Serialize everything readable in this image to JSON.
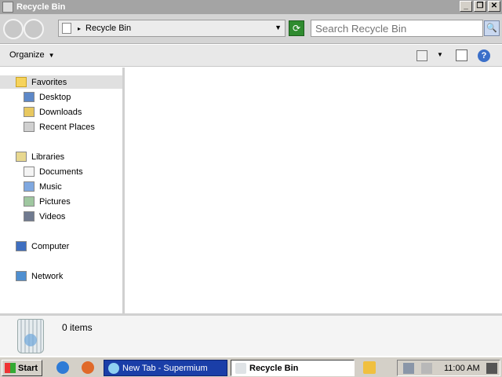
{
  "window": {
    "title": "Recycle Bin",
    "controls": {
      "minimize": "_",
      "maximize": "❐",
      "close": "✕"
    }
  },
  "address": {
    "arrow": "▸",
    "location": "Recycle Bin",
    "dropdown": "▼",
    "refresh_glyph": "⟳"
  },
  "search": {
    "placeholder": "Search Recycle Bin",
    "button_glyph": "🔍"
  },
  "toolbar": {
    "organize": "Organize",
    "caret": "▼",
    "view_caret": "▼",
    "help": "?"
  },
  "nav": {
    "favorites": "Favorites",
    "desktop": "Desktop",
    "downloads": "Downloads",
    "recent": "Recent Places",
    "libraries": "Libraries",
    "documents": "Documents",
    "music": "Music",
    "pictures": "Pictures",
    "videos": "Videos",
    "computer": "Computer",
    "network": "Network"
  },
  "details": {
    "items_count": "0 items"
  },
  "taskbar": {
    "start": "Start",
    "tasks": [
      "New Tab - Supermium",
      "Recycle Bin"
    ],
    "clock": "11:00 AM"
  },
  "colors": {
    "accent": "#1a3ea8",
    "titlebar": "#a4a4a4"
  }
}
